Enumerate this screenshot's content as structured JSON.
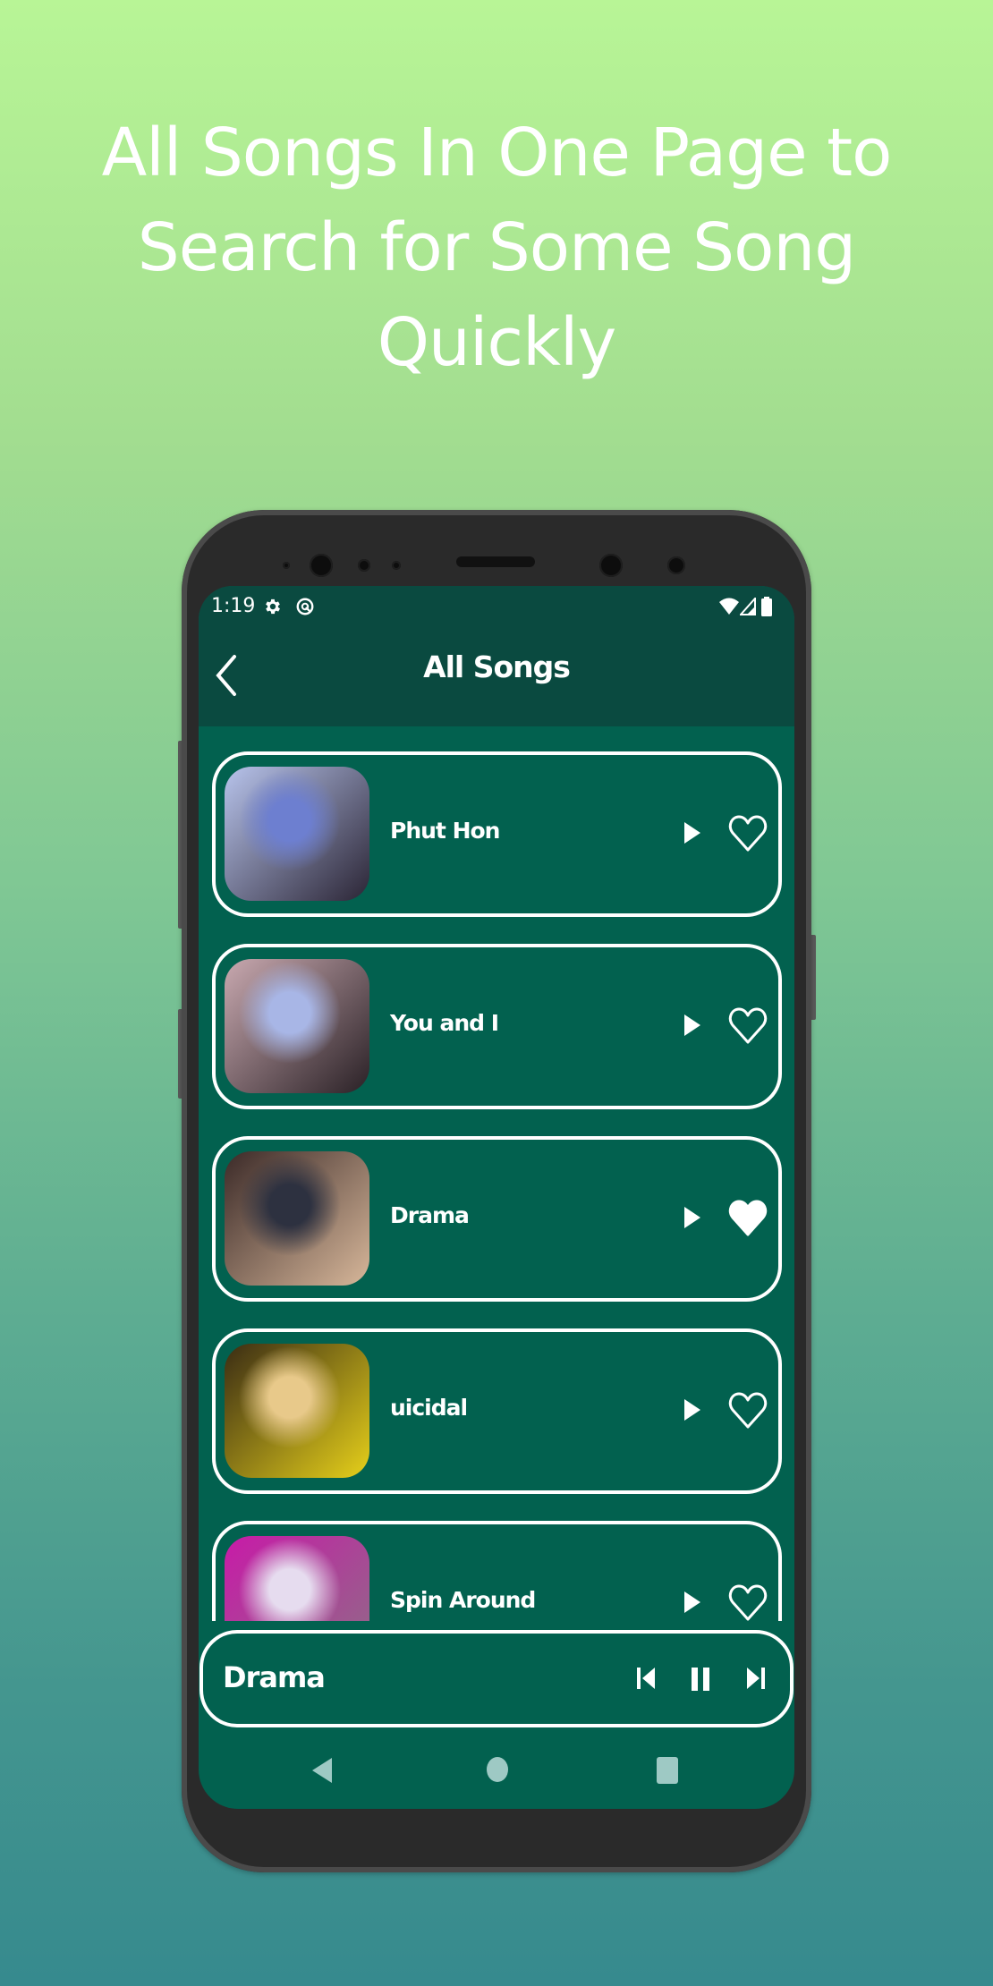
{
  "headline": {
    "line1": "All Songs In One Page to",
    "line2": "Search for Some Song",
    "line3": "Quickly"
  },
  "status_bar": {
    "time": "1:19",
    "left_icons": [
      "gear-icon",
      "data-saver-icon"
    ],
    "right_icons": [
      "wifi-icon",
      "cell-signal-icon",
      "battery-icon"
    ]
  },
  "app_bar": {
    "back_icon": "chevron-left-icon",
    "title": "All Songs"
  },
  "songs": [
    {
      "title": "Phut Hon",
      "favorite": false,
      "thumb_colors": [
        "#b8c4ec",
        "#6d7fd0",
        "#2b2535"
      ]
    },
    {
      "title": "You and I",
      "favorite": false,
      "thumb_colors": [
        "#c9a9b0",
        "#a8b6e6",
        "#2a2126"
      ]
    },
    {
      "title": "Drama",
      "favorite": true,
      "thumb_colors": [
        "#3b2a28",
        "#2d3140",
        "#d7b79a"
      ]
    },
    {
      "title": "uicidal",
      "favorite": false,
      "thumb_colors": [
        "#3a2c14",
        "#e8c98a",
        "#e6d01a"
      ]
    },
    {
      "title": "Spin Around",
      "favorite": false,
      "thumb_colors": [
        "#c81aa8",
        "#e6dcef",
        "#8e6d86"
      ]
    }
  ],
  "now_playing": {
    "title": "Drama",
    "controls": [
      "skip-previous-icon",
      "pause-icon",
      "skip-next-icon"
    ]
  },
  "nav_bar": [
    "back-triangle-icon",
    "home-circle-icon",
    "recents-square-icon"
  ],
  "colors": {
    "header": "#0a4a40",
    "list_bg": "#02614f",
    "accent": "#ffffff"
  }
}
